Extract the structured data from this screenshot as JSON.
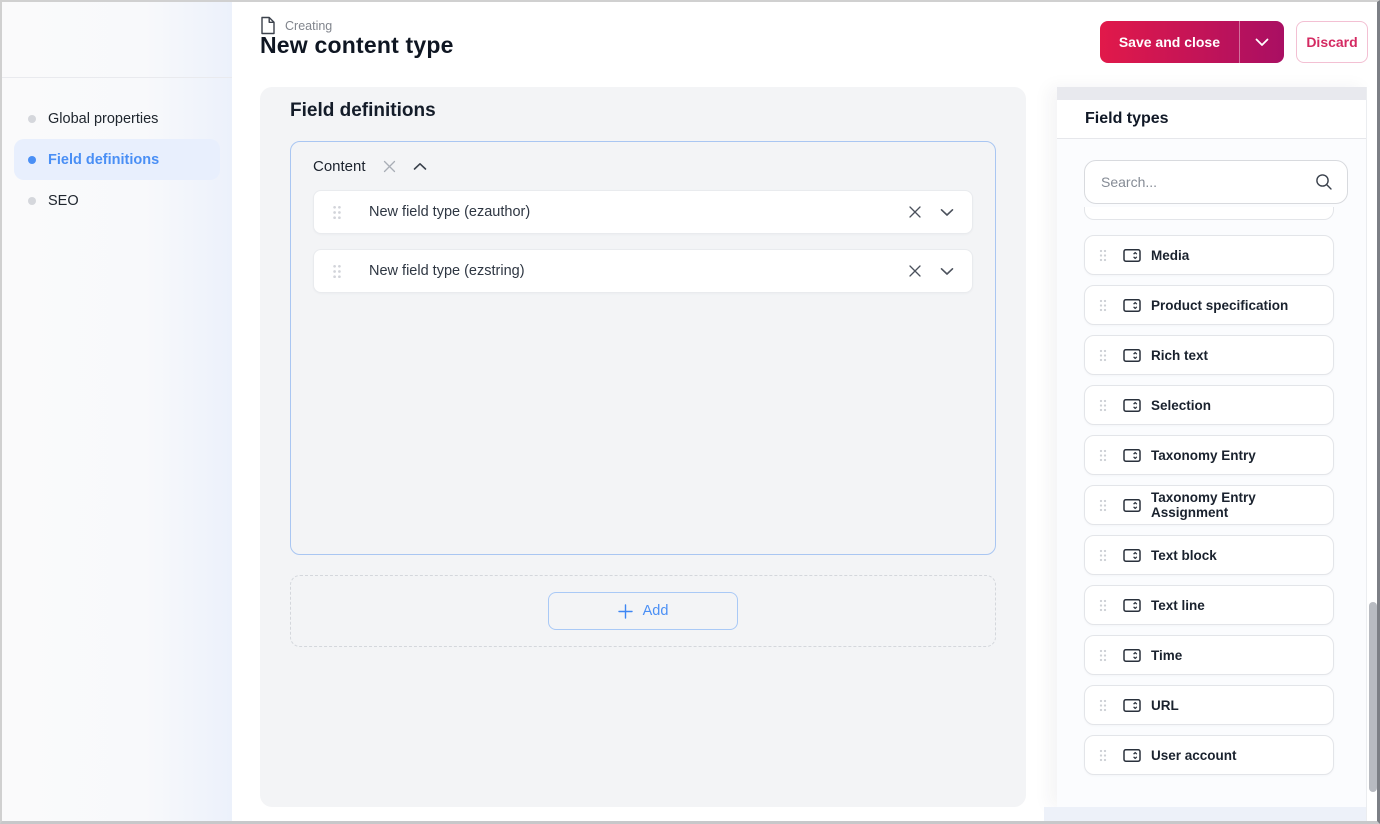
{
  "colors": {
    "accent-blue": "#4a8ff5",
    "accent-blue-bg": "#e8effd",
    "brand-gradient-start": "#e1194a",
    "brand-gradient-end": "#a90f63",
    "discard-text": "#d42a62",
    "discard-border": "#f3c0d3",
    "panel-bg": "#f3f4f6"
  },
  "header": {
    "kicker": "Creating",
    "title": "New content type",
    "save_label": "Save and close",
    "discard_label": "Discard"
  },
  "sidebar": {
    "items": [
      {
        "label": "Global properties",
        "active": false
      },
      {
        "label": "Field definitions",
        "active": true
      },
      {
        "label": "SEO",
        "active": false
      }
    ]
  },
  "main": {
    "section_title": "Field definitions",
    "group": {
      "name": "Content",
      "fields": [
        "New field type (ezauthor)",
        "New field type (ezstring)"
      ]
    },
    "add_label": "Add"
  },
  "panel": {
    "title": "Field types",
    "search_placeholder": "Search...",
    "items": [
      "Media",
      "Product specification",
      "Rich text",
      "Selection",
      "Taxonomy Entry",
      "Taxonomy Entry Assignment",
      "Text block",
      "Text line",
      "Time",
      "URL",
      "User account"
    ]
  },
  "icons": {
    "kicker": "document-icon",
    "save_menu": "chevron-down-icon",
    "group_remove": "close-icon",
    "group_collapse": "chevron-up-icon",
    "row_remove": "close-icon",
    "row_expand": "chevron-down-icon",
    "add": "plus-icon",
    "search": "search-icon",
    "drag": "drag-handle-icon",
    "field_type": "field-input-icon"
  }
}
